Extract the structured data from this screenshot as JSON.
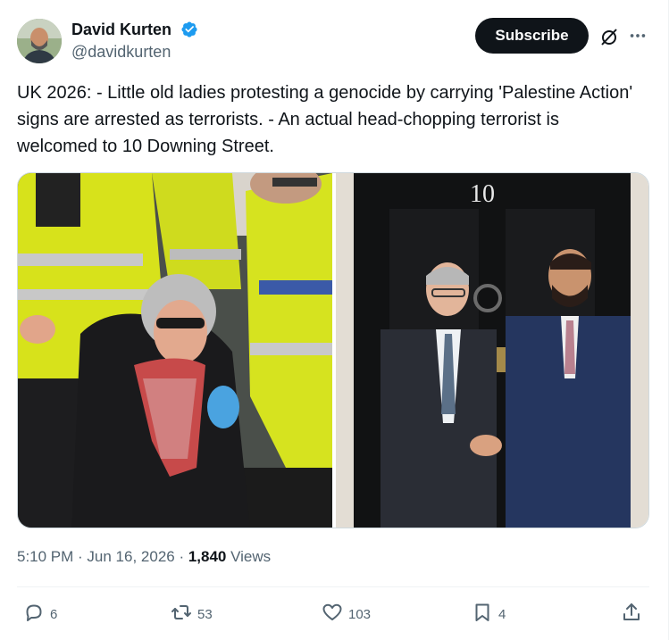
{
  "author": {
    "name": "David Kurten",
    "handle": "@davidkurten",
    "verified": true
  },
  "header": {
    "subscribe_label": "Subscribe",
    "icons": [
      "grok-icon",
      "more-icon"
    ]
  },
  "tweet": {
    "text": "UK 2026: - Little old ladies protesting a genocide by carrying 'Palestine Action' signs are arrested as terrorists. - An actual head-chopping terrorist is welcomed to 10 Downing Street.",
    "media": [
      {
        "kind": "photo",
        "subject": "police officers arresting an elderly woman"
      },
      {
        "kind": "photo",
        "subject": "two men shaking hands at a black door",
        "door_number": "10"
      }
    ]
  },
  "meta": {
    "time": "5:10 PM",
    "sep1": " · ",
    "date": "Jun 16, 2026",
    "sep2": " · ",
    "views_count": "1,840",
    "views_label": " Views"
  },
  "actions": {
    "reply": "6",
    "repost": "53",
    "like": "103",
    "bookmark": "4"
  },
  "colors": {
    "text": "#0f1419",
    "secondary": "#536471",
    "verified": "#1d9bf0",
    "button": "#0f1419",
    "divider": "#eff3f4"
  }
}
